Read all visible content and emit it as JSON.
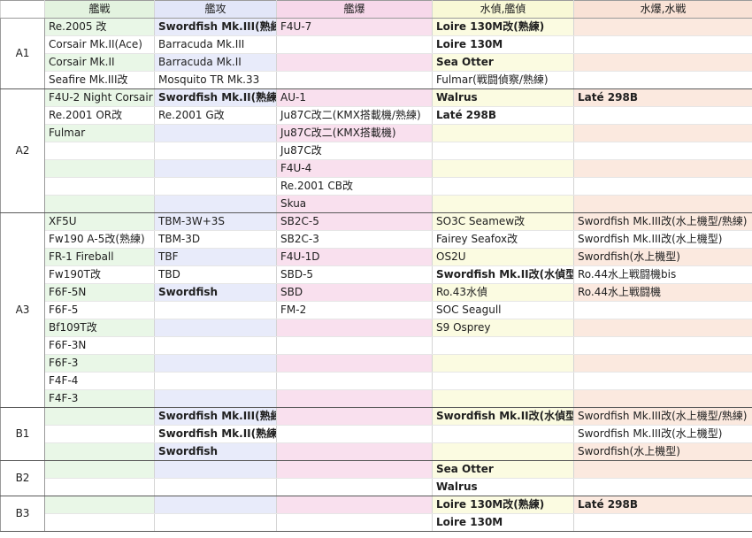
{
  "colors": {
    "carrier_fighter": "#e9f7e7",
    "torpedo_bomber": "#e8ebfa",
    "dive_bomber": "#f9e0ee",
    "recon": "#fbfbe1",
    "seaplane": "#fbe9df"
  },
  "headers": [
    "",
    "艦戦",
    "艦攻",
    "艦爆",
    "水偵,艦偵",
    "水爆,水戦"
  ],
  "groups": [
    {
      "tier": "A1",
      "rows": [
        [
          {
            "t": "Re.2005 改",
            "b": false
          },
          {
            "t": "Swordfish Mk.III(熟練)",
            "b": true
          },
          {
            "t": "F4U-7",
            "b": false
          },
          {
            "t": "Loire 130M改(熟練)",
            "b": true
          },
          {
            "t": "",
            "b": false
          }
        ],
        [
          {
            "t": "Corsair Mk.II(Ace)",
            "b": false
          },
          {
            "t": "Barracuda Mk.III",
            "b": false
          },
          {
            "t": "",
            "b": false
          },
          {
            "t": "Loire 130M",
            "b": true
          },
          {
            "t": "",
            "b": false
          }
        ],
        [
          {
            "t": "Corsair Mk.II",
            "b": false
          },
          {
            "t": "Barracuda Mk.II",
            "b": false
          },
          {
            "t": "",
            "b": false
          },
          {
            "t": "Sea Otter",
            "b": true
          },
          {
            "t": "",
            "b": false
          }
        ],
        [
          {
            "t": "Seafire Mk.III改",
            "b": false
          },
          {
            "t": "Mosquito TR Mk.33",
            "b": false
          },
          {
            "t": "",
            "b": false
          },
          {
            "t": "Fulmar(戦闘偵察/熟練)",
            "b": false
          },
          {
            "t": "",
            "b": false
          }
        ]
      ]
    },
    {
      "tier": "A2",
      "rows": [
        [
          {
            "t": "F4U-2 Night Corsair",
            "b": false
          },
          {
            "t": "Swordfish Mk.II(熟練)",
            "b": true
          },
          {
            "t": "AU-1",
            "b": false
          },
          {
            "t": "Walrus",
            "b": true
          },
          {
            "t": "Laté 298B",
            "b": true
          }
        ],
        [
          {
            "t": "Re.2001 OR改",
            "b": false
          },
          {
            "t": "Re.2001 G改",
            "b": false
          },
          {
            "t": "Ju87C改二(KMX搭載機/熟練)",
            "b": false
          },
          {
            "t": "Laté 298B",
            "b": true
          },
          {
            "t": "",
            "b": false
          }
        ],
        [
          {
            "t": "Fulmar",
            "b": false
          },
          {
            "t": "",
            "b": false
          },
          {
            "t": "Ju87C改二(KMX搭載機)",
            "b": false
          },
          {
            "t": "",
            "b": false
          },
          {
            "t": "",
            "b": false
          }
        ],
        [
          {
            "t": "",
            "b": false
          },
          {
            "t": "",
            "b": false
          },
          {
            "t": "Ju87C改",
            "b": false
          },
          {
            "t": "",
            "b": false
          },
          {
            "t": "",
            "b": false
          }
        ],
        [
          {
            "t": "",
            "b": false
          },
          {
            "t": "",
            "b": false
          },
          {
            "t": "F4U-4",
            "b": false
          },
          {
            "t": "",
            "b": false
          },
          {
            "t": "",
            "b": false
          }
        ],
        [
          {
            "t": "",
            "b": false
          },
          {
            "t": "",
            "b": false
          },
          {
            "t": "Re.2001 CB改",
            "b": false
          },
          {
            "t": "",
            "b": false
          },
          {
            "t": "",
            "b": false
          }
        ],
        [
          {
            "t": "",
            "b": false
          },
          {
            "t": "",
            "b": false
          },
          {
            "t": "Skua",
            "b": false
          },
          {
            "t": "",
            "b": false
          },
          {
            "t": "",
            "b": false
          }
        ]
      ]
    },
    {
      "tier": "A3",
      "rows": [
        [
          {
            "t": "XF5U",
            "b": false
          },
          {
            "t": "TBM-3W+3S",
            "b": false
          },
          {
            "t": "SB2C-5",
            "b": false
          },
          {
            "t": "SO3C Seamew改",
            "b": false
          },
          {
            "t": "Swordfish Mk.III改(水上機型/熟練)",
            "b": false
          }
        ],
        [
          {
            "t": "Fw190 A-5改(熟練)",
            "b": false
          },
          {
            "t": "TBM-3D",
            "b": false
          },
          {
            "t": "SB2C-3",
            "b": false
          },
          {
            "t": "Fairey Seafox改",
            "b": false
          },
          {
            "t": "Swordfish Mk.III改(水上機型)",
            "b": false
          }
        ],
        [
          {
            "t": "FR-1 Fireball",
            "b": false
          },
          {
            "t": "TBF",
            "b": false
          },
          {
            "t": "F4U-1D",
            "b": false
          },
          {
            "t": "OS2U",
            "b": false
          },
          {
            "t": "Swordfish(水上機型)",
            "b": false
          }
        ],
        [
          {
            "t": "Fw190T改",
            "b": false
          },
          {
            "t": "TBD",
            "b": false
          },
          {
            "t": "SBD-5",
            "b": false
          },
          {
            "t": "Swordfish Mk.II改(水偵型)",
            "b": true
          },
          {
            "t": "Ro.44水上戦闘機bis",
            "b": false
          }
        ],
        [
          {
            "t": "F6F-5N",
            "b": false
          },
          {
            "t": "Swordfish",
            "b": true
          },
          {
            "t": "SBD",
            "b": false
          },
          {
            "t": "Ro.43水偵",
            "b": false
          },
          {
            "t": "Ro.44水上戦闘機",
            "b": false
          }
        ],
        [
          {
            "t": "F6F-5",
            "b": false
          },
          {
            "t": "",
            "b": false
          },
          {
            "t": "FM-2",
            "b": false
          },
          {
            "t": "SOC Seagull",
            "b": false
          },
          {
            "t": "",
            "b": false
          }
        ],
        [
          {
            "t": "Bf109T改",
            "b": false
          },
          {
            "t": "",
            "b": false
          },
          {
            "t": "",
            "b": false
          },
          {
            "t": "S9 Osprey",
            "b": false
          },
          {
            "t": "",
            "b": false
          }
        ],
        [
          {
            "t": "F6F-3N",
            "b": false
          },
          {
            "t": "",
            "b": false
          },
          {
            "t": "",
            "b": false
          },
          {
            "t": "",
            "b": false
          },
          {
            "t": "",
            "b": false
          }
        ],
        [
          {
            "t": "F6F-3",
            "b": false
          },
          {
            "t": "",
            "b": false
          },
          {
            "t": "",
            "b": false
          },
          {
            "t": "",
            "b": false
          },
          {
            "t": "",
            "b": false
          }
        ],
        [
          {
            "t": "F4F-4",
            "b": false
          },
          {
            "t": "",
            "b": false
          },
          {
            "t": "",
            "b": false
          },
          {
            "t": "",
            "b": false
          },
          {
            "t": "",
            "b": false
          }
        ],
        [
          {
            "t": "F4F-3",
            "b": false
          },
          {
            "t": "",
            "b": false
          },
          {
            "t": "",
            "b": false
          },
          {
            "t": "",
            "b": false
          },
          {
            "t": "",
            "b": false
          }
        ]
      ]
    },
    {
      "tier": "B1",
      "rows": [
        [
          {
            "t": "",
            "b": false
          },
          {
            "t": "Swordfish Mk.III(熟練)",
            "b": true
          },
          {
            "t": "",
            "b": false
          },
          {
            "t": "Swordfish Mk.II改(水偵型)",
            "b": true
          },
          {
            "t": "Swordfish Mk.III改(水上機型/熟練)",
            "b": false
          }
        ],
        [
          {
            "t": "",
            "b": false
          },
          {
            "t": "Swordfish Mk.II(熟練)",
            "b": true
          },
          {
            "t": "",
            "b": false
          },
          {
            "t": "",
            "b": false
          },
          {
            "t": "Swordfish Mk.III改(水上機型)",
            "b": false
          }
        ],
        [
          {
            "t": "",
            "b": false
          },
          {
            "t": "Swordfish",
            "b": true
          },
          {
            "t": "",
            "b": false
          },
          {
            "t": "",
            "b": false
          },
          {
            "t": "Swordfish(水上機型)",
            "b": false
          }
        ]
      ]
    },
    {
      "tier": "B2",
      "rows": [
        [
          {
            "t": "",
            "b": false
          },
          {
            "t": "",
            "b": false
          },
          {
            "t": "",
            "b": false
          },
          {
            "t": "Sea Otter",
            "b": true
          },
          {
            "t": "",
            "b": false
          }
        ],
        [
          {
            "t": "",
            "b": false
          },
          {
            "t": "",
            "b": false
          },
          {
            "t": "",
            "b": false
          },
          {
            "t": "Walrus",
            "b": true
          },
          {
            "t": "",
            "b": false
          }
        ]
      ]
    },
    {
      "tier": "B3",
      "rows": [
        [
          {
            "t": "",
            "b": false
          },
          {
            "t": "",
            "b": false
          },
          {
            "t": "",
            "b": false
          },
          {
            "t": "Loire 130M改(熟練)",
            "b": true
          },
          {
            "t": "Laté 298B",
            "b": true
          }
        ],
        [
          {
            "t": "",
            "b": false
          },
          {
            "t": "",
            "b": false
          },
          {
            "t": "",
            "b": false
          },
          {
            "t": "Loire 130M",
            "b": true
          },
          {
            "t": "",
            "b": false
          }
        ]
      ]
    }
  ]
}
